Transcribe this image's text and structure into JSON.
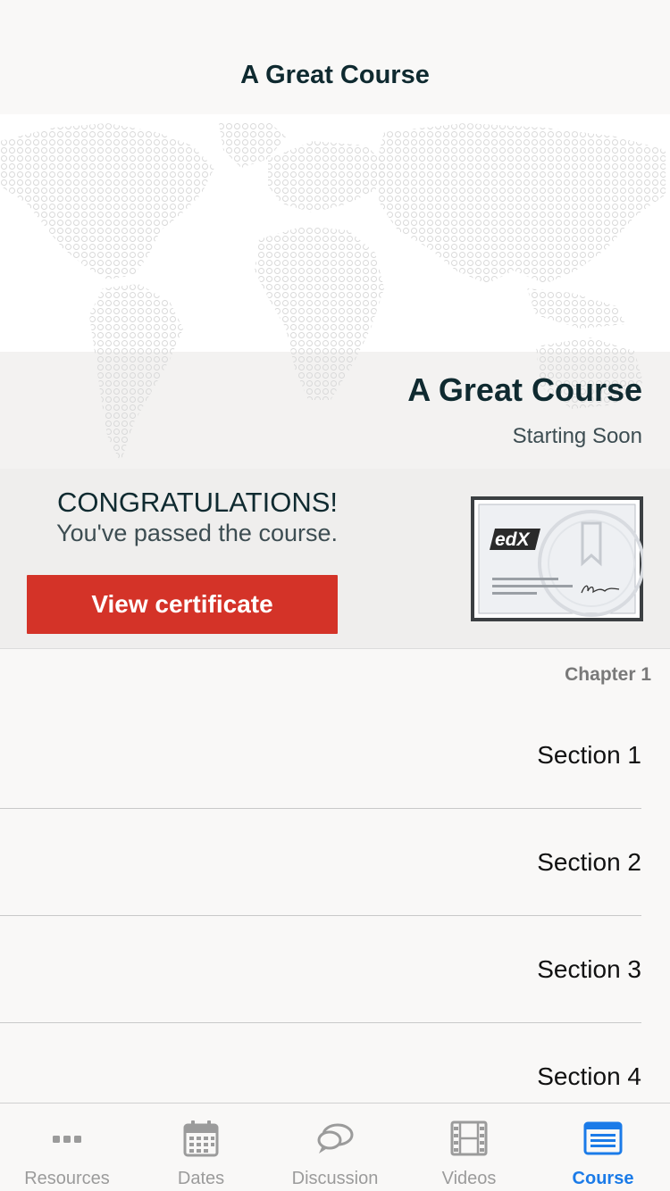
{
  "nav": {
    "title": "A Great Course"
  },
  "hero": {
    "course_title": "A Great Course",
    "status": "Starting Soon"
  },
  "certificate": {
    "title": "CONGRATULATIONS!",
    "subtitle": "You've passed the course.",
    "button_label": "View certificate",
    "logo_text": "edX"
  },
  "outline": {
    "chapter": "Chapter 1",
    "sections": [
      "Section 1",
      "Section 2",
      "Section 3",
      "Section 4"
    ]
  },
  "tabs": [
    {
      "label": "Resources",
      "icon": "more-dots-icon",
      "active": false
    },
    {
      "label": "Dates",
      "icon": "calendar-icon",
      "active": false
    },
    {
      "label": "Discussion",
      "icon": "discussion-bubbles-icon",
      "active": false
    },
    {
      "label": "Videos",
      "icon": "film-icon",
      "active": false
    },
    {
      "label": "Course",
      "icon": "course-list-icon",
      "active": true
    }
  ],
  "colors": {
    "accent": "#1b7be8",
    "primary_button": "#d43328",
    "text_dark": "#0f2a30",
    "tab_inactive": "#9b9b9b"
  }
}
